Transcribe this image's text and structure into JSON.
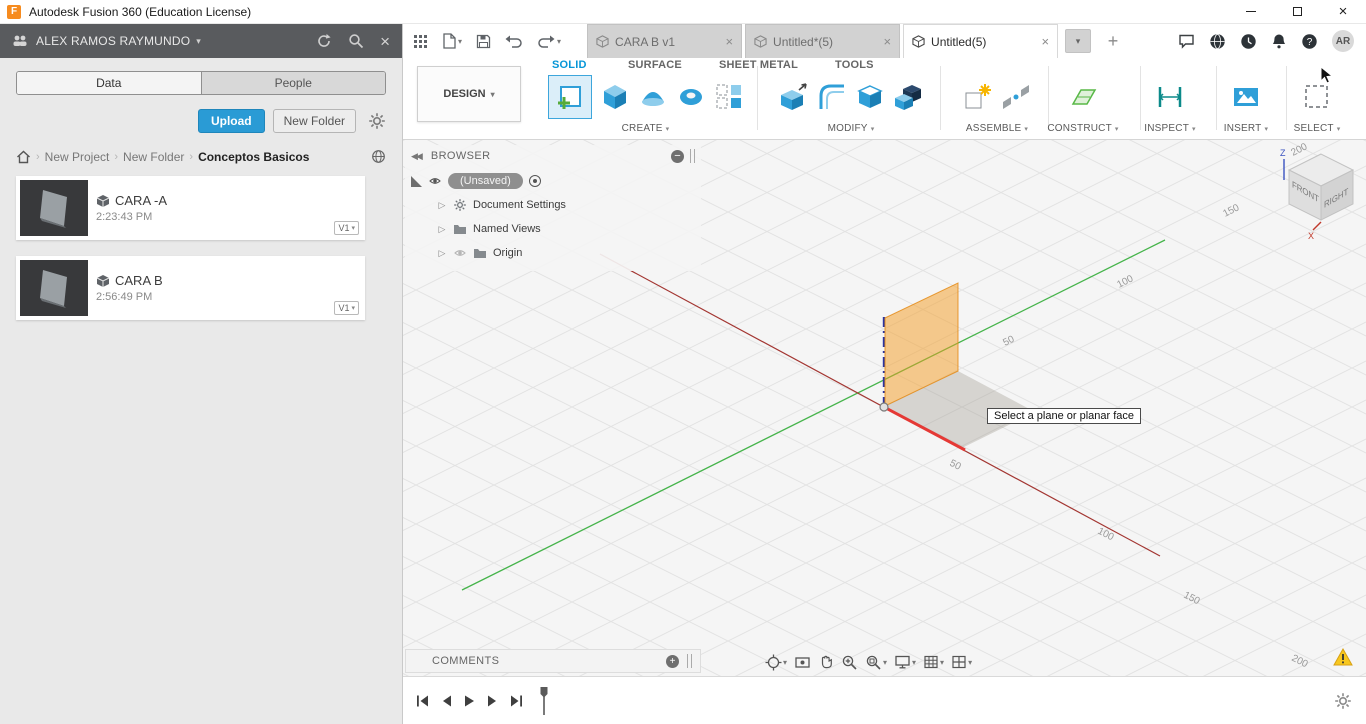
{
  "titlebar": {
    "title": "Autodesk Fusion 360 (Education License)"
  },
  "data_panel": {
    "user_name": "ALEX RAMOS RAYMUNDO",
    "tab_data": "Data",
    "tab_people": "People",
    "upload": "Upload",
    "new_folder": "New Folder",
    "breadcrumb": [
      "New Project",
      "New Folder",
      "Conceptos Basicos"
    ],
    "files": [
      {
        "name": "CARA -A",
        "time": "2:23:43 PM",
        "version": "V1"
      },
      {
        "name": "CARA B",
        "time": "2:56:49 PM",
        "version": "V1"
      }
    ]
  },
  "doc_tabs": [
    {
      "label": "CARA B v1"
    },
    {
      "label": "Untitled*(5)"
    },
    {
      "label": "Untitled(5)"
    }
  ],
  "account": {
    "avatar": "AR"
  },
  "ribbon": {
    "workspace": "DESIGN",
    "tabs": [
      "SOLID",
      "SURFACE",
      "SHEET METAL",
      "TOOLS"
    ],
    "groups": [
      "CREATE",
      "MODIFY",
      "ASSEMBLE",
      "CONSTRUCT",
      "INSPECT",
      "INSERT",
      "SELECT"
    ]
  },
  "browser": {
    "title": "BROWSER",
    "root_label": "(Unsaved)",
    "rows": [
      "Document Settings",
      "Named Views",
      "Origin"
    ]
  },
  "viewport": {
    "tooltip": "Select a plane or planar face",
    "green_axis_labels": [
      "50",
      "100",
      "150",
      "200"
    ],
    "red_axis_labels": [
      "50",
      "100",
      "150",
      "200"
    ],
    "viewcube": {
      "front": "FRONT",
      "right": "RIGHT",
      "z": "Z",
      "x": "X"
    }
  },
  "comments": {
    "title": "COMMENTS"
  },
  "colors": {
    "accent_blue": "#0696d7",
    "highlight_orange": "#f5a623",
    "axis_green": "#46b44b",
    "axis_red": "#d03f36"
  }
}
